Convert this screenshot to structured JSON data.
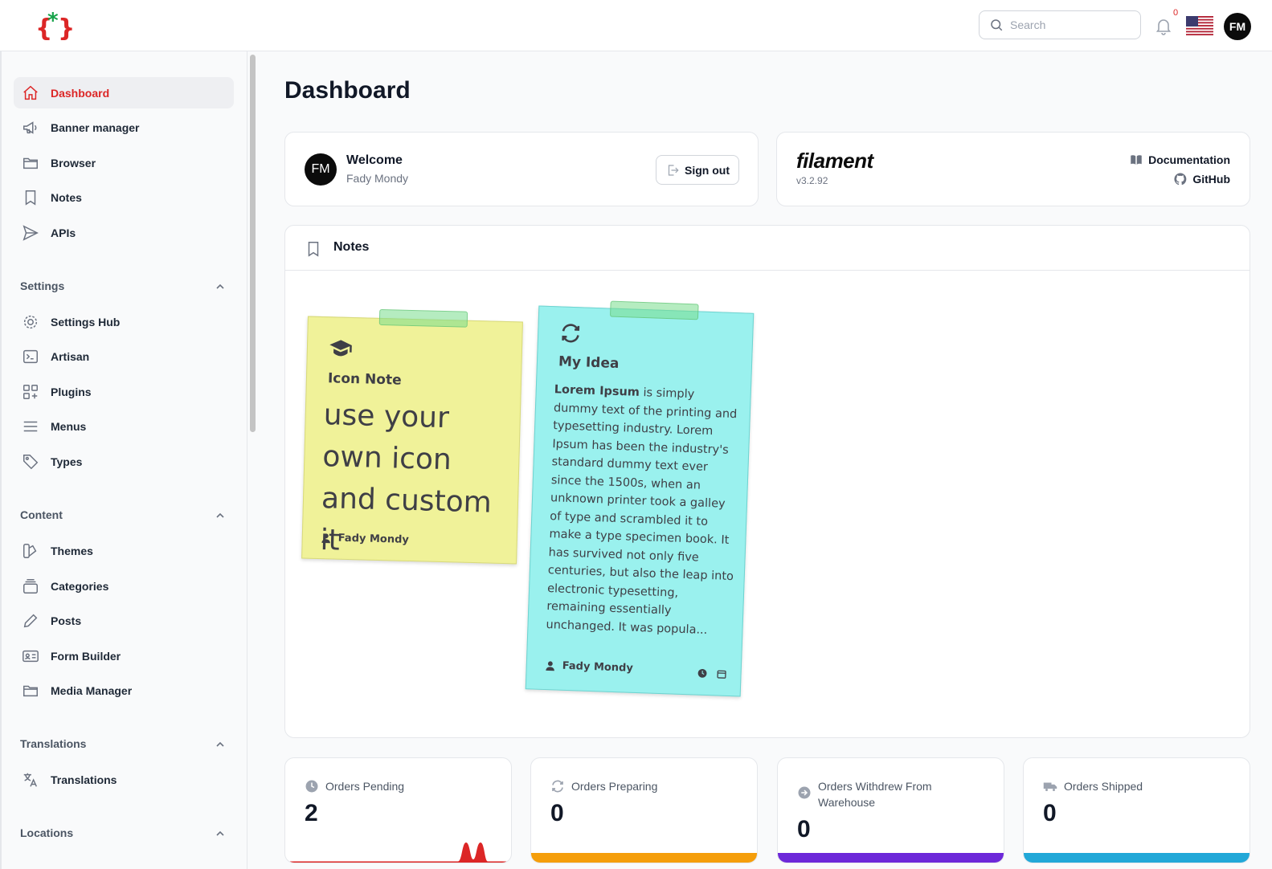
{
  "topbar": {
    "search_placeholder": "Search",
    "notification_count": "0",
    "user_initials": "FM"
  },
  "sidebar": {
    "items": [
      {
        "label": "Dashboard",
        "icon": "home-icon"
      },
      {
        "label": "Banner manager",
        "icon": "megaphone-icon"
      },
      {
        "label": "Browser",
        "icon": "folder-icon"
      },
      {
        "label": "Notes",
        "icon": "bookmark-icon"
      },
      {
        "label": "APIs",
        "icon": "paper-plane-icon"
      }
    ],
    "groups": [
      {
        "label": "Settings",
        "items": [
          {
            "label": "Settings Hub",
            "icon": "cog-icon"
          },
          {
            "label": "Artisan",
            "icon": "terminal-icon"
          },
          {
            "label": "Plugins",
            "icon": "squares-plus-icon"
          },
          {
            "label": "Menus",
            "icon": "bars-icon"
          },
          {
            "label": "Types",
            "icon": "tag-icon"
          }
        ]
      },
      {
        "label": "Content",
        "items": [
          {
            "label": "Themes",
            "icon": "swatch-icon"
          },
          {
            "label": "Categories",
            "icon": "stack-icon"
          },
          {
            "label": "Posts",
            "icon": "pencil-icon"
          },
          {
            "label": "Form Builder",
            "icon": "id-card-icon"
          },
          {
            "label": "Media Manager",
            "icon": "folder-icon"
          }
        ]
      },
      {
        "label": "Translations",
        "items": [
          {
            "label": "Translations",
            "icon": "language-icon"
          }
        ]
      },
      {
        "label": "Locations",
        "items": []
      }
    ]
  },
  "main": {
    "title": "Dashboard",
    "welcome": {
      "avatar": "FM",
      "title": "Welcome",
      "name": "Fady Mondy",
      "signout_label": "Sign out"
    },
    "filament": {
      "logo": "filament",
      "version": "v3.2.92",
      "docs_label": "Documentation",
      "github_label": "GitHub"
    },
    "notes": {
      "title": "Notes",
      "items": [
        {
          "title": "Icon Note",
          "body": "use your own icon and custom it",
          "author": "Fady Mondy",
          "color": "#f0f299"
        },
        {
          "title": "My Idea",
          "body_bold": "Lorem Ipsum",
          "body": " is simply dummy text of the printing and typesetting industry. Lorem Ipsum has been the industry's standard dummy text ever since the 1500s, when an unknown printer took a galley of type and scrambled it to make a type specimen book. It has survived not only five centuries, but also the leap into electronic typesetting, remaining essentially unchanged. It was popula...",
          "author": "Fady Mondy",
          "color": "#9af1ee"
        }
      ]
    },
    "stats": [
      {
        "label": "Orders Pending",
        "value": "2",
        "icon": "clock-icon",
        "bar_color": "#dc2626"
      },
      {
        "label": "Orders Preparing",
        "value": "0",
        "icon": "arrows-rotate-icon",
        "bar_color": "#f59e0b"
      },
      {
        "label": "Orders Withdrew From Warehouse",
        "value": "0",
        "icon": "arrow-circle-icon",
        "bar_color": "#6d28d9"
      },
      {
        "label": "Orders Shipped",
        "value": "0",
        "icon": "truck-icon",
        "bar_color": "#22a8d8"
      }
    ]
  },
  "colors": {
    "accent": "#dc2626",
    "logo_green": "#16a34a"
  }
}
